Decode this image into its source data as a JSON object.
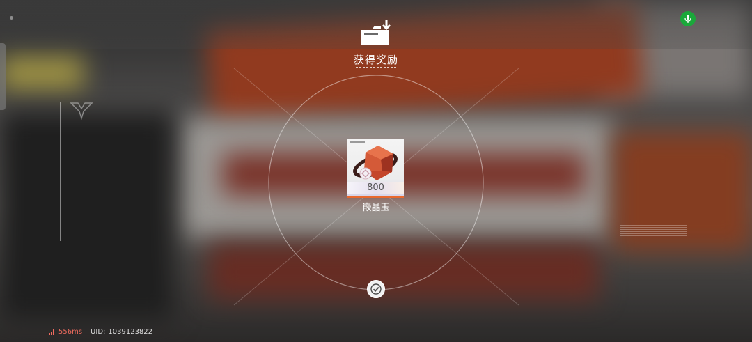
{
  "reward_panel": {
    "title": "获得奖励",
    "items": [
      {
        "name": "嵌晶玉",
        "quantity": "800"
      }
    ]
  },
  "status_bar": {
    "ping": "556ms",
    "uid_label": "UID:",
    "uid_value": "1039123822"
  },
  "colors": {
    "accent_orange": "#e8692e",
    "mic_green": "#1aa83a",
    "ping_red": "#ee6b5e"
  },
  "icons": {
    "title": "reward-box-icon",
    "mic": "microphone-icon",
    "confirm": "checkmark-icon",
    "signal": "signal-bars-icon"
  }
}
